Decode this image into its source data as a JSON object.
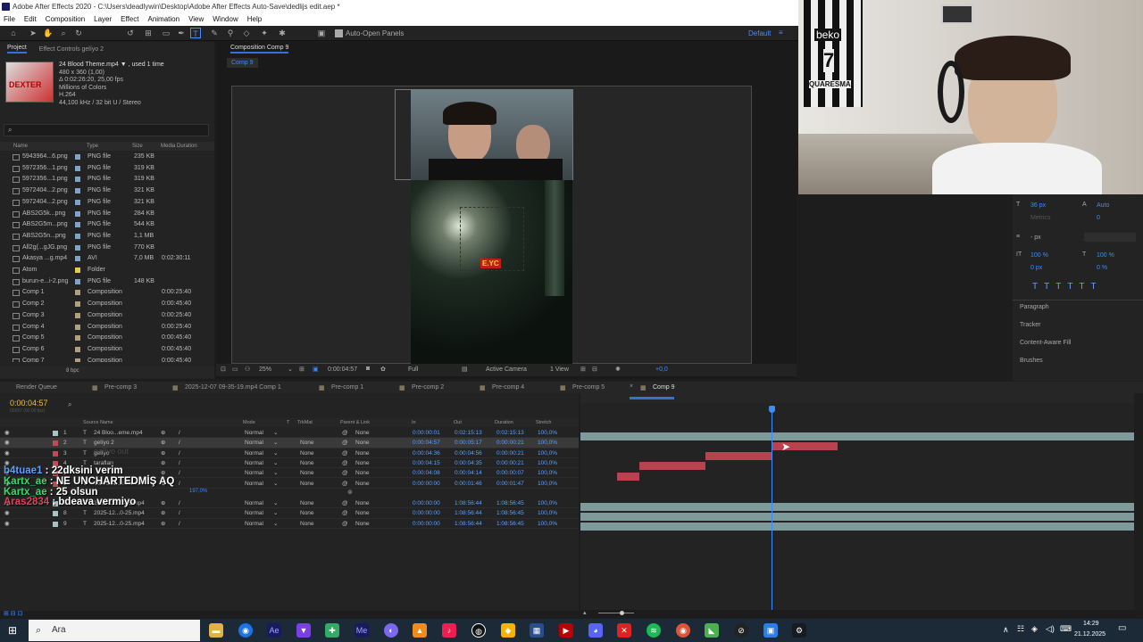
{
  "window": {
    "title": "Adobe After Effects 2020 - C:\\Users\\deadlywin\\Desktop\\Adobe After Effects Auto-Save\\dedlijs edit.aep *"
  },
  "menu": [
    "File",
    "Edit",
    "Composition",
    "Layer",
    "Effect",
    "Animation",
    "View",
    "Window",
    "Help"
  ],
  "toolbar": {
    "auto_open": "Auto-Open Panels",
    "workspace": "Default"
  },
  "project": {
    "tab_label": "Project",
    "effect_controls": "Effect Controls gelíyo 2",
    "thumb_label": "DEXTER",
    "info": [
      "24 Blood Theme.mp4 ▼ , used 1 time",
      "480 x 360 (1,00)",
      "Δ 0:02:26:20, 25,00 fps",
      "Millions of Colors",
      "H.264",
      "44,100 kHz / 32 bit U / Stereo"
    ],
    "columns": [
      "Name",
      "Type",
      "Size",
      "Media Duration"
    ],
    "items": [
      {
        "name": "5943964...6.png",
        "type": "PNG file",
        "size": "235 KB",
        "dur": "",
        "color": "#7fa3c7",
        "icon": "image-icon"
      },
      {
        "name": "5972356...1.png",
        "type": "PNG file",
        "size": "319 KB",
        "dur": "",
        "color": "#7fa3c7",
        "icon": "image-icon"
      },
      {
        "name": "5972356...1.png",
        "type": "PNG file",
        "size": "319 KB",
        "dur": "",
        "color": "#7fa3c7",
        "icon": "image-icon"
      },
      {
        "name": "5972404...2.png",
        "type": "PNG file",
        "size": "321 KB",
        "dur": "",
        "color": "#7fa3c7",
        "icon": "image-icon"
      },
      {
        "name": "5972404...2.png",
        "type": "PNG file",
        "size": "321 KB",
        "dur": "",
        "color": "#7fa3c7",
        "icon": "image-icon"
      },
      {
        "name": "ABS2G5k...png",
        "type": "PNG file",
        "size": "284 KB",
        "dur": "",
        "color": "#7fa3c7",
        "icon": "image-icon"
      },
      {
        "name": "ABS2G5m...png",
        "type": "PNG file",
        "size": "544 KB",
        "dur": "",
        "color": "#7fa3c7",
        "icon": "image-icon"
      },
      {
        "name": "ABS2G5n...png",
        "type": "PNG file",
        "size": "1,1 MB",
        "dur": "",
        "color": "#7fa3c7",
        "icon": "image-icon"
      },
      {
        "name": "All2g(...gJG.png",
        "type": "PNG file",
        "size": "770 KB",
        "dur": "",
        "color": "#7fa3c7",
        "icon": "image-icon"
      },
      {
        "name": "Akasya ...g.mp4",
        "type": "AVI",
        "size": "7,0 MB",
        "dur": "0:02:30:11",
        "color": "#7fa3c7",
        "icon": "video-icon"
      },
      {
        "name": "Atom",
        "type": "Folder",
        "size": "",
        "dur": "",
        "color": "#e6c84a",
        "icon": "folder-icon"
      },
      {
        "name": "burun-e...i-2.png",
        "type": "PNG file",
        "size": "148 KB",
        "dur": "",
        "color": "#7fa3c7",
        "icon": "image-icon"
      },
      {
        "name": "Comp 1",
        "type": "Composition",
        "size": "",
        "dur": "0:00:25:40",
        "color": "#b0a080",
        "icon": "composition-icon"
      },
      {
        "name": "Comp 2",
        "type": "Composition",
        "size": "",
        "dur": "0:00:45:40",
        "color": "#b0a080",
        "icon": "composition-icon"
      },
      {
        "name": "Comp 3",
        "type": "Composition",
        "size": "",
        "dur": "0:00:25:40",
        "color": "#b0a080",
        "icon": "composition-icon"
      },
      {
        "name": "Comp 4",
        "type": "Composition",
        "size": "",
        "dur": "0:00:25:40",
        "color": "#b0a080",
        "icon": "composition-icon"
      },
      {
        "name": "Comp 5",
        "type": "Composition",
        "size": "",
        "dur": "0:00:45:40",
        "color": "#b0a080",
        "icon": "composition-icon"
      },
      {
        "name": "Comp 6",
        "type": "Composition",
        "size": "",
        "dur": "0:00:45:40",
        "color": "#b0a080",
        "icon": "composition-icon"
      },
      {
        "name": "Comp 7",
        "type": "Composition",
        "size": "",
        "dur": "0:00:45:40",
        "color": "#b0a080",
        "icon": "composition-icon"
      }
    ],
    "footer": "8 bpc"
  },
  "composition": {
    "tab": "Composition Comp 9",
    "crumb": "Comp 9",
    "zoom": "25%",
    "time": "0:00:04:57",
    "quality": "Full",
    "camera": "Active Camera",
    "view": "1 View",
    "exposure": "+0,0",
    "text_overlay": "E.YC"
  },
  "right_panel": {
    "font_size": "36 px",
    "leading": "Auto",
    "metrics": "Metrics",
    "tracking": "0",
    "stroke_unit": "- px",
    "vscale": "100 %",
    "hscale": "100 %",
    "baseline": "0 px",
    "tsume": "0 %",
    "sections": [
      "Paragraph",
      "Tracker",
      "Content-Aware Fill",
      "Brushes"
    ]
  },
  "timeline": {
    "tabs": [
      "Render Queue",
      "Pre-comp 3",
      "2025-12-07 09-35-19.mp4 Comp 1",
      "Pre-comp 1",
      "Pre-comp 2",
      "Pre-comp 4",
      "Pre-comp 5",
      "Comp 9"
    ],
    "timecode": "0:00:04:57",
    "fps": "00257 (60.00 fps)",
    "columns": [
      "Source Name",
      "Mode",
      "T",
      "TrkMat",
      "Parent & Link",
      "In",
      "Out",
      "Duration",
      "Stretch"
    ],
    "ruler": [
      "04:00f",
      "10f",
      "20f",
      "30f",
      "40f",
      "50f",
      "05:00f",
      "10f",
      "20f",
      "30f",
      "40f",
      "50f",
      "06:00f",
      "10f",
      "20f",
      "30f",
      "50"
    ],
    "layers": [
      {
        "num": "1",
        "name": "24 Bloo...eme.mp4",
        "mode": "Normal",
        "trk": "",
        "parent": "None",
        "in": "0:00:00:01",
        "out": "0:02:15:13",
        "dur": "0:02:15:13",
        "stretch": "100,0%",
        "label": "#a7c4c4"
      },
      {
        "num": "2",
        "name": "gelíyo 2",
        "mode": "Normal",
        "trk": "None",
        "parent": "None",
        "in": "0:00:04:57",
        "out": "0:00:05:17",
        "dur": "0:00:00:21",
        "stretch": "100,0%",
        "label": "#c04b55"
      },
      {
        "num": "3",
        "name": "gelíyo",
        "mode": "Normal",
        "trk": "None",
        "parent": "None",
        "in": "0:00:04:36",
        "out": "0:00:04:56",
        "dur": "0:00:00:21",
        "stretch": "100,0%",
        "label": "#c04b55"
      },
      {
        "num": "4",
        "name": "tarafları",
        "mode": "Normal",
        "trk": "None",
        "parent": "None",
        "in": "0:00:04:15",
        "out": "0:00:04:35",
        "dur": "0:00:00:21",
        "stretch": "100,0%",
        "label": "#c04b55"
      },
      {
        "num": "5",
        "name": "",
        "mode": "Normal",
        "trk": "None",
        "parent": "None",
        "in": "0:00:04:08",
        "out": "0:00:04:14",
        "dur": "0:00:00:07",
        "stretch": "100,0%",
        "label": "#c04b55"
      },
      {
        "num": "6",
        "name": "korkmak...k var mı?",
        "mode": "Normal",
        "trk": "None",
        "parent": "None",
        "in": "0:00:00:00",
        "out": "0:00:01:46",
        "dur": "0:00:01:47",
        "stretch": "100,0%",
        "label": "#c04b55"
      },
      {
        "num": "7",
        "name": "2025-12...0-25.mp4",
        "mode": "Normal",
        "trk": "None",
        "parent": "None",
        "in": "0:00:00:00",
        "out": "1:08:56:44",
        "dur": "1:08:56:45",
        "stretch": "100,0%",
        "label": "#a7c4c4"
      },
      {
        "num": "8",
        "name": "2025-12...0-25.mp4",
        "mode": "Normal",
        "trk": "None",
        "parent": "None",
        "in": "0:00:00:00",
        "out": "1:08:56:44",
        "dur": "1:08:56:45",
        "stretch": "100,0%",
        "label": "#a7c4c4"
      },
      {
        "num": "9",
        "name": "2025-12...0-25.mp4",
        "mode": "Normal",
        "trk": "None",
        "parent": "None",
        "in": "0:00:00:00",
        "out": "1:08:56:44",
        "dur": "1:08:56:45",
        "stretch": "100,0%",
        "label": "#a7c4c4"
      }
    ],
    "scale_readout": "197,0%"
  },
  "chat": [
    {
      "user": "b4tuae1",
      "msg": "22dksini verim",
      "color": "#5aa0ff"
    },
    {
      "user": "Kartx_ae",
      "msg": "NE UNCHARTEDMİŞ AQ",
      "color": "#2ee06a"
    },
    {
      "user": "Kartx_ae",
      "msg": "25 olsun",
      "color": "#2ee06a"
    },
    {
      "user": "Aras2834",
      "msg": "bdeava vermiyo",
      "color": "#e0405a"
    }
  ],
  "overlay_faded": "gelíyo out",
  "webcam": {
    "jersey_brand": "beko",
    "jersey_number": "7",
    "jersey_name": "QUARESMA"
  },
  "taskbar": {
    "search": "Ara",
    "time": "14:29",
    "date": "21.12.2025"
  }
}
